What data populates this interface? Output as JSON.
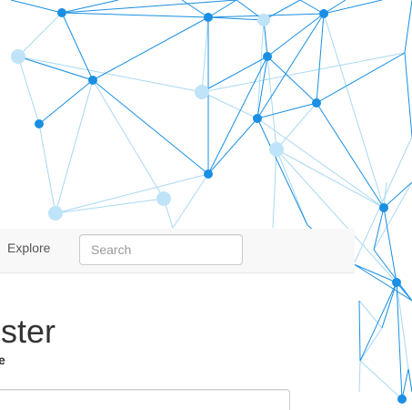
{
  "colors": {
    "node_dark": "#1a8fe3",
    "node_light": "#bfe3f8",
    "line_dark": "#1a8fe3",
    "line_light": "#a9d8f2",
    "navbar_bg": "#f8f8f8",
    "text": "#333333"
  },
  "nav": {
    "explore_label": "Explore"
  },
  "search": {
    "placeholder": "Search",
    "value": ""
  },
  "form": {
    "title": "ister",
    "field_label": "e",
    "field_value": ""
  }
}
